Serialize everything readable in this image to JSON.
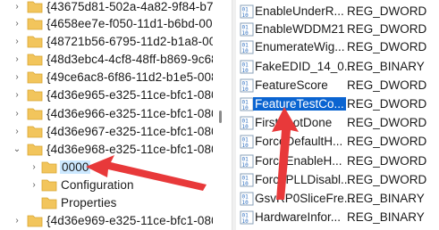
{
  "tree": {
    "rows": [
      {
        "label": "{43675d81-502a-4a82-9f84-b75f",
        "expanded": false,
        "level": 0
      },
      {
        "label": "{4658ee7e-f050-11d1-b6bd-00c",
        "expanded": false,
        "level": 0
      },
      {
        "label": "{48721b56-6795-11d2-b1a8-008",
        "expanded": false,
        "level": 0
      },
      {
        "label": "{48d3ebc4-4cf8-48ff-b869-9c68a",
        "expanded": false,
        "level": 0
      },
      {
        "label": "{49ce6ac8-6f86-11d2-b1e5-0080",
        "expanded": false,
        "level": 0
      },
      {
        "label": "{4d36e965-e325-11ce-bfc1-0800",
        "expanded": false,
        "level": 0
      },
      {
        "label": "{4d36e966-e325-11ce-bfc1-0800",
        "expanded": false,
        "level": 0
      },
      {
        "label": "{4d36e967-e325-11ce-bfc1-0800",
        "expanded": false,
        "level": 0
      },
      {
        "label": "{4d36e968-e325-11ce-bfc1-0800",
        "expanded": true,
        "level": 0
      },
      {
        "label": "0000",
        "expanded": false,
        "level": 1,
        "selected": true
      },
      {
        "label": "Configuration",
        "expanded": false,
        "level": 1
      },
      {
        "label": "Properties",
        "expanded": null,
        "level": 1
      },
      {
        "label": "{4d36e969-e325-11ce-bfc1-0800",
        "expanded": false,
        "level": 0
      }
    ]
  },
  "values": {
    "rows": [
      {
        "name": "EnableUnderR...",
        "type": "REG_DWORD",
        "icon": "binary-value-icon"
      },
      {
        "name": "EnableWDDM21",
        "type": "REG_DWORD",
        "icon": "binary-value-icon"
      },
      {
        "name": "EnumerateWig...",
        "type": "REG_DWORD",
        "icon": "binary-value-icon"
      },
      {
        "name": "FakeEDID_14_0...",
        "type": "REG_BINARY",
        "icon": "binary-value-icon"
      },
      {
        "name": "FeatureScore",
        "type": "REG_DWORD",
        "icon": "binary-value-icon"
      },
      {
        "name": "FeatureTestCo...",
        "type": "REG_DWORD",
        "icon": "binary-value-icon",
        "selected": true
      },
      {
        "name": "FirstBootDone",
        "type": "REG_DWORD",
        "icon": "binary-value-icon"
      },
      {
        "name": "ForceDefaultH...",
        "type": "REG_DWORD",
        "icon": "binary-value-icon"
      },
      {
        "name": "ForceEnableH...",
        "type": "REG_DWORD",
        "icon": "binary-value-icon"
      },
      {
        "name": "ForcePLLDisabl...",
        "type": "REG_DWORD",
        "icon": "binary-value-icon"
      },
      {
        "name": "GsvRP0SliceFre...",
        "type": "REG_BINARY",
        "icon": "binary-value-icon"
      },
      {
        "name": "HardwareInfor...",
        "type": "REG_BINARY",
        "icon": "binary-value-icon"
      }
    ]
  },
  "colors": {
    "folder": "#f2c55c",
    "selection_focus": "#0a64d1",
    "selection_tree": "#cce8ff",
    "annotation_arrow": "#e8393a"
  }
}
